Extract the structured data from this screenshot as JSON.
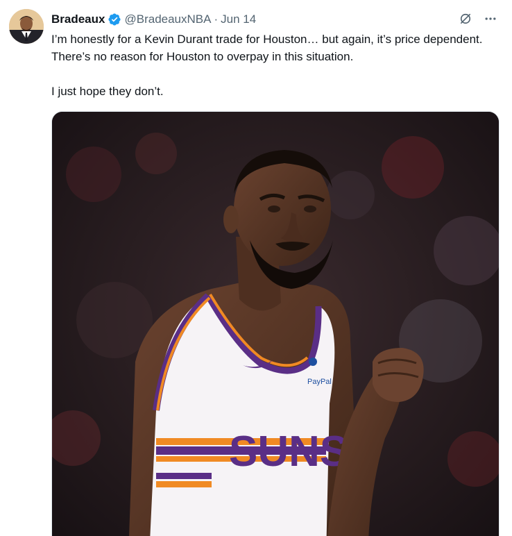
{
  "author": {
    "display_name": "Bradeaux",
    "handle": "@BradeauxNBA",
    "separator": "·",
    "date": "Jun 14",
    "verified": true,
    "verified_color": "#1d9bf0"
  },
  "tweet": {
    "paragraphs": [
      "I’m honestly for a Kevin Durant trade for Houston… but again, it’s price dependent. There’s no reason for Houston to overpay in this situation.",
      "I just hope they don’t."
    ]
  },
  "media": {
    "jersey_text": "SUNS",
    "patch_text": "PayPal"
  },
  "icons": {
    "verified": "verified-badge-icon",
    "grok": "grok-icon",
    "more": "more-icon"
  },
  "colors": {
    "text_primary": "#0f1419",
    "text_secondary": "#536471",
    "accent": "#1d9bf0",
    "jersey_purple": "#5a2e86",
    "jersey_orange": "#f08a24"
  }
}
